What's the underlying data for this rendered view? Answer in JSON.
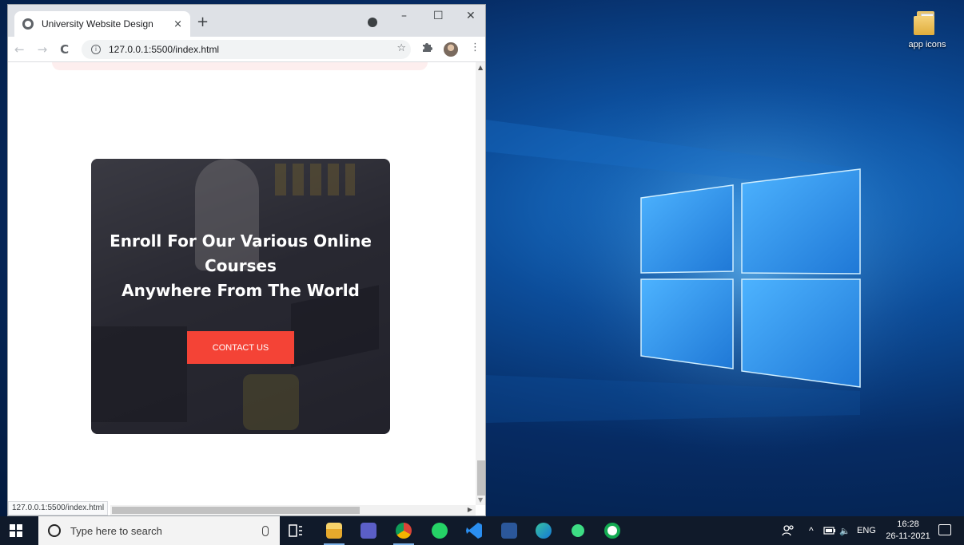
{
  "browser": {
    "tab_title": "University Website Design",
    "tab_close": "×",
    "new_tab": "+",
    "url": "127.0.0.1:5500/index.html",
    "window_controls": {
      "minimize": "–",
      "maximize": "☐",
      "close": "✕"
    },
    "nav": {
      "back": "←",
      "forward": "→",
      "reload": "C"
    },
    "toolbar_icons": {
      "star": "☆",
      "extensions": "puzzle-icon",
      "menu": "⋮"
    },
    "status_url": "127.0.0.1:5500/index.html"
  },
  "page": {
    "enroll_heading_line1": "Enroll For Our Various Online",
    "enroll_heading_line2": "Courses",
    "enroll_heading_line3": "Anywhere From The World",
    "contact_button": "CONTACT US",
    "button_color": "#f44336"
  },
  "desktop": {
    "icon_label": "app icons"
  },
  "taskbar": {
    "search_placeholder": "Type here to search",
    "apps": [
      "task-view-icon",
      "file-explorer-icon",
      "teams-icon",
      "chrome-icon",
      "whatsapp-icon",
      "vscode-icon",
      "word-icon",
      "edge-icon",
      "android-studio-icon",
      "mongodb-compass-icon"
    ],
    "tray": {
      "language": "ENG",
      "time": "16:28",
      "date": "26-11-2021",
      "caret": "^",
      "volume": "🔈"
    }
  }
}
